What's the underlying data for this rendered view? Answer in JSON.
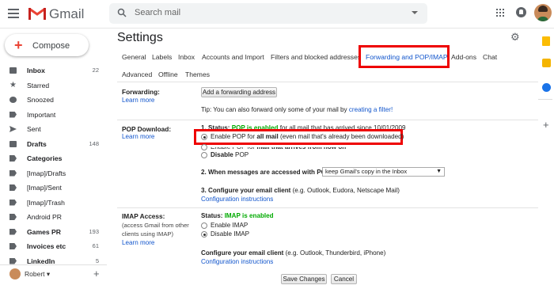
{
  "header": {
    "app_name": "Gmail",
    "search_placeholder": "Search mail",
    "colors": {
      "gmail_red": "#ea4335",
      "link": "#1155cc",
      "highlight": "#ee0000",
      "enabled_green": "#00aa00"
    }
  },
  "sidebar": {
    "compose_label": "Compose",
    "items": [
      {
        "label": "Inbox",
        "count": "22",
        "bold": true,
        "icon": "inbox-icon"
      },
      {
        "label": "Starred",
        "count": "",
        "bold": false,
        "icon": "star-icon"
      },
      {
        "label": "Snoozed",
        "count": "",
        "bold": false,
        "icon": "clock-icon"
      },
      {
        "label": "Important",
        "count": "",
        "bold": false,
        "icon": "important-icon"
      },
      {
        "label": "Sent",
        "count": "",
        "bold": false,
        "icon": "send-icon"
      },
      {
        "label": "Drafts",
        "count": "148",
        "bold": true,
        "icon": "draft-icon"
      },
      {
        "label": "Categories",
        "count": "",
        "bold": true,
        "icon": "label-icon"
      },
      {
        "label": "[Imap]/Drafts",
        "count": "",
        "bold": false,
        "icon": "label-icon"
      },
      {
        "label": "[Imap]/Sent",
        "count": "",
        "bold": false,
        "icon": "label-icon"
      },
      {
        "label": "[Imap]/Trash",
        "count": "",
        "bold": false,
        "icon": "label-icon"
      },
      {
        "label": "Android PR",
        "count": "",
        "bold": false,
        "icon": "label-icon"
      },
      {
        "label": "Games PR",
        "count": "193",
        "bold": true,
        "icon": "label-icon"
      },
      {
        "label": "Invoices etc",
        "count": "61",
        "bold": true,
        "icon": "label-icon"
      },
      {
        "label": "LinkedIn",
        "count": "5",
        "bold": true,
        "icon": "label-icon"
      }
    ],
    "user_name": "Robert"
  },
  "settings": {
    "title": "Settings",
    "tabs_row1": [
      "General",
      "Labels",
      "Inbox",
      "Accounts and Import",
      "Filters and blocked addresses",
      "Forwarding and POP/IMAP",
      "Add-ons",
      "Chat"
    ],
    "tabs_row2": [
      "Advanced",
      "Offline",
      "Themes"
    ],
    "active_tab": "Forwarding and POP/IMAP",
    "forwarding": {
      "label": "Forwarding:",
      "learn_more": "Learn more",
      "add_button": "Add a forwarding address",
      "tip_prefix": "Tip: You can also forward only some of your mail by",
      "tip_link": "creating a filter!"
    },
    "pop": {
      "label": "POP Download:",
      "learn_more": "Learn more",
      "status_prefix": "1. Status:",
      "status_value": "POP is enabled",
      "status_suffix": "for all mail that has arrived since 10/01/2009",
      "option1_prefix": "Enable POP for",
      "option1_bold": "all mail",
      "option1_suffix": "(even mail that's already been downloaded)",
      "option2_prefix": "Enable POP for",
      "option2_bold": "mail that arrives from now on",
      "option3_bold": "Disable",
      "option3_suffix": "POP",
      "when_accessed_label": "2. When messages are accessed with POP",
      "when_accessed_value": "keep Gmail's copy in the Inbox",
      "configure_label": "3. Configure your email client",
      "configure_hint": "(e.g. Outlook, Eudora, Netscape Mail)",
      "config_link": "Configuration instructions"
    },
    "imap": {
      "label": "IMAP Access:",
      "sublabel_line1": "(access Gmail from other",
      "sublabel_line2": "clients using IMAP)",
      "learn_more": "Learn more",
      "status_prefix": "Status:",
      "status_value": "IMAP is enabled",
      "option_enable": "Enable IMAP",
      "option_disable": "Disable IMAP",
      "configure_label": "Configure your email client",
      "configure_hint": "(e.g. Outlook, Thunderbird, iPhone)",
      "config_link": "Configuration instructions"
    },
    "save_button": "Save Changes",
    "cancel_button": "Cancel"
  }
}
